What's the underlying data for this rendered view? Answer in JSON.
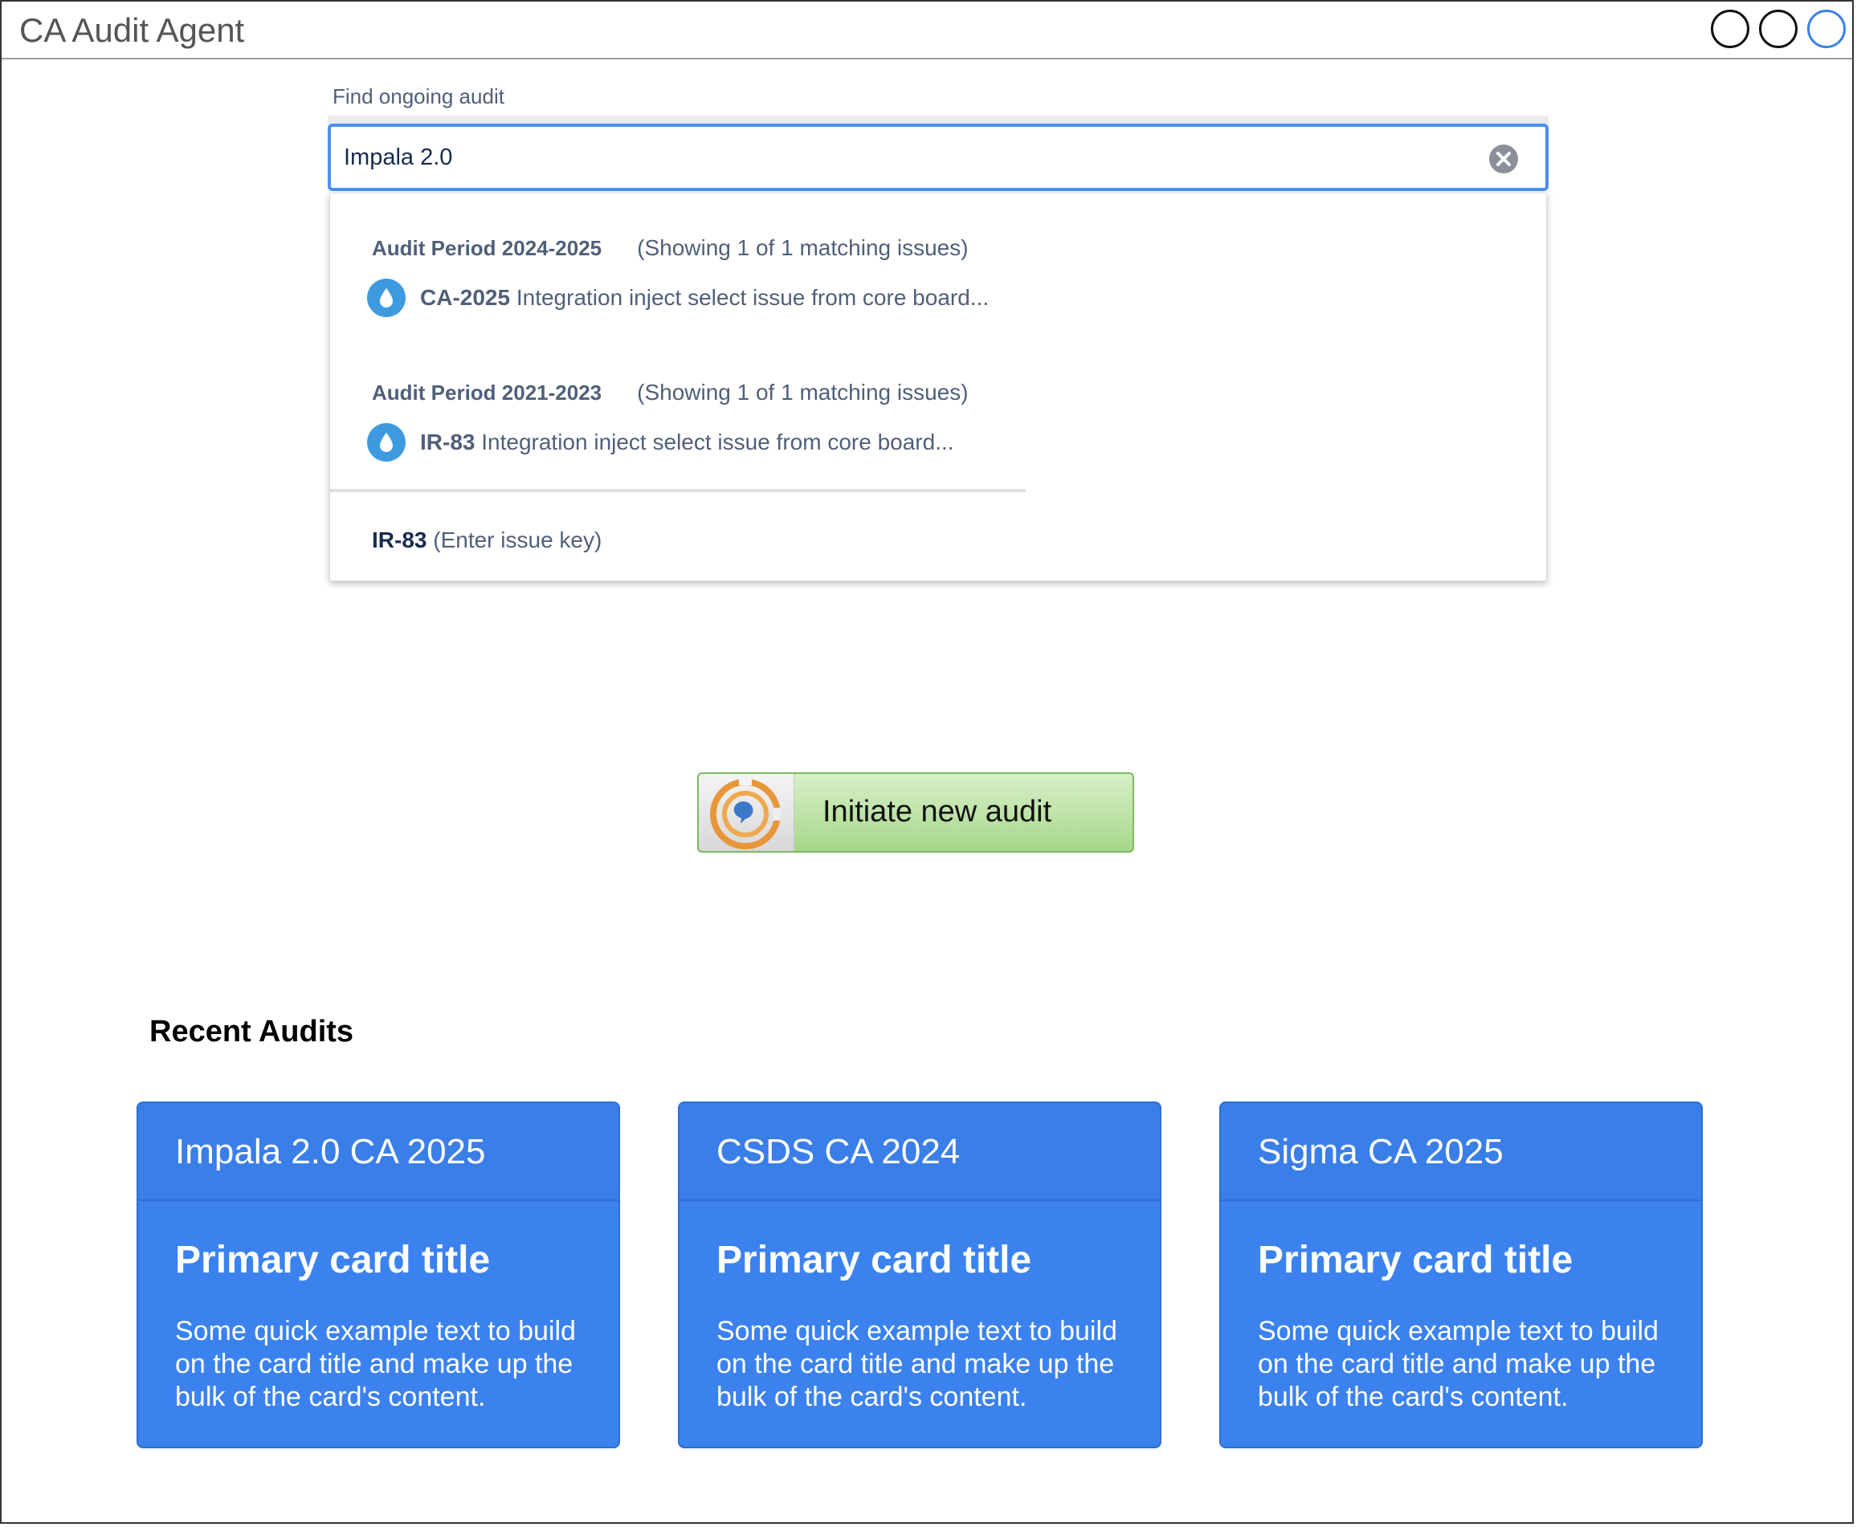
{
  "window": {
    "title": "CA Audit Agent"
  },
  "search": {
    "label": "Find ongoing audit",
    "value": "Impala 2.0",
    "groups": [
      {
        "period": "Audit Period 2024-2025",
        "count_text": "(Showing 1 of 1 matching issues)",
        "item": {
          "key": "CA-2025",
          "summary": "Integration inject select issue from core board...",
          "icon": "drop-icon"
        }
      },
      {
        "period": "Audit Period 2021-2023",
        "count_text": "(Showing 1 of 1 matching issues)",
        "item": {
          "key": "IR-83",
          "summary": "Integration inject select issue from core board...",
          "icon": "drop-icon"
        }
      }
    ],
    "enter_key": {
      "key": "IR-83",
      "hint": "(Enter issue key)"
    }
  },
  "initiate_button": {
    "label": "Initiate new audit"
  },
  "recent": {
    "heading": "Recent Audits",
    "cards": [
      {
        "header": "Impala 2.0 CA 2025",
        "title": "Primary card title",
        "text": "Some quick example text to build on the card title and make up the bulk of the card's content."
      },
      {
        "header": "CSDS CA 2024",
        "title": "Primary card title",
        "text": "Some quick example text to build on the card title and make up the bulk of the card's content."
      },
      {
        "header": "Sigma CA 2025",
        "title": "Primary card title",
        "text": "Some quick example text to build on the card title and make up the bulk of the card's content."
      }
    ]
  },
  "colors": {
    "accent": "#4c8ff0",
    "card_blue": "#3b82ef",
    "issue_icon": "#3d9ae0",
    "button_green": "#a5d88a"
  }
}
